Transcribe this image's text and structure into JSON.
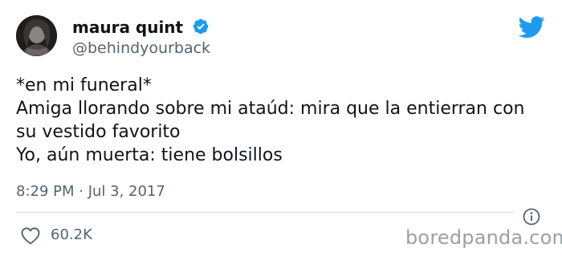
{
  "tweet": {
    "display_name": "maura quint",
    "handle": "@behindyourback",
    "verified": true,
    "body_lines": [
      "*en mi funeral*",
      "Amiga llorando sobre mi ataúd: mira que la entierran con",
      "su vestido favorito",
      "Yo, aún muerta: tiene bolsillos"
    ],
    "timestamp": "8:29 PM · Jul 3, 2017",
    "like_count": "60.2K"
  },
  "icons": {
    "avatar": "avatar-photo",
    "verified": "verified-badge-icon",
    "twitter": "twitter-bird-icon",
    "info": "info-icon",
    "like": "heart-icon"
  },
  "colors": {
    "text": "#0f1419",
    "muted": "#536471",
    "twitter_blue": "#1d9bf0",
    "watermark": "#9aa0a6"
  },
  "watermark": "boredpanda.com"
}
